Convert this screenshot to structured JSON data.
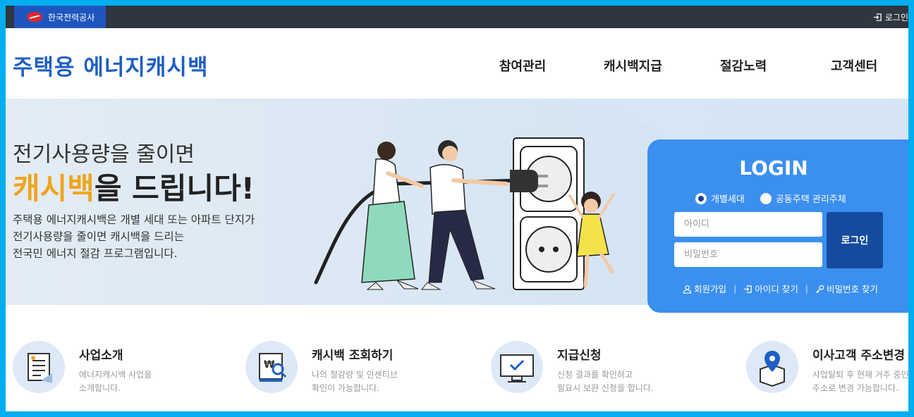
{
  "topbar": {
    "org_name": "한국전력공사",
    "login_label": "로그인"
  },
  "brand": {
    "title": "주택용 에너지캐시백"
  },
  "nav": [
    {
      "label": "참여관리"
    },
    {
      "label": "캐시백지급"
    },
    {
      "label": "절감노력"
    },
    {
      "label": "고객센터"
    }
  ],
  "hero": {
    "line1": "전기사용량을 줄이면",
    "line2_highlight": "캐시백",
    "line2_rest": "을 드립니다!",
    "desc": [
      "주택용 에너지캐시백은 개별 세대 또는 아파트 단지가",
      "전기사용량을 줄이면 캐시백을 드리는",
      "전국민 에너지 절감 프로그램입니다."
    ]
  },
  "login": {
    "title": "LOGIN",
    "options": [
      {
        "label": "개별세대",
        "selected": true
      },
      {
        "label": "공동주택 관리주체",
        "selected": false
      }
    ],
    "id_placeholder": "아이디",
    "pw_placeholder": "비밀번호",
    "button_label": "로그인",
    "links": [
      {
        "label": "회원가입",
        "icon": "user-icon"
      },
      {
        "label": "아이디 찾기",
        "icon": "login-enter-icon"
      },
      {
        "label": "비밀번호 찾기",
        "icon": "key-icon"
      }
    ]
  },
  "services": [
    {
      "title": "사업소개",
      "desc1": "에너지캐시백 사업을",
      "desc2": "소개합니다.",
      "icon": "document-icon"
    },
    {
      "title": "캐시백 조회하기",
      "desc1": "나의 절감량 및 인센티브",
      "desc2": "확인이 가능합니다.",
      "icon": "won-search-icon"
    },
    {
      "title": "지급신청",
      "desc1": "신청 결과를 확인하고",
      "desc2": "필요시 보완 신청을 합니다.",
      "icon": "monitor-check-icon"
    },
    {
      "title": "이사고객 주소변경",
      "desc1": "사업탈퇴 후 현재 거주 중인",
      "desc2": "주소로 변경 가능합니다.",
      "icon": "map-pin-icon"
    }
  ],
  "colors": {
    "brand": "#1f5fc4",
    "highlight": "#f0a41d",
    "login_panel": "#3b8fef",
    "login_button": "#154a9e",
    "topbar": "#2f3640"
  }
}
